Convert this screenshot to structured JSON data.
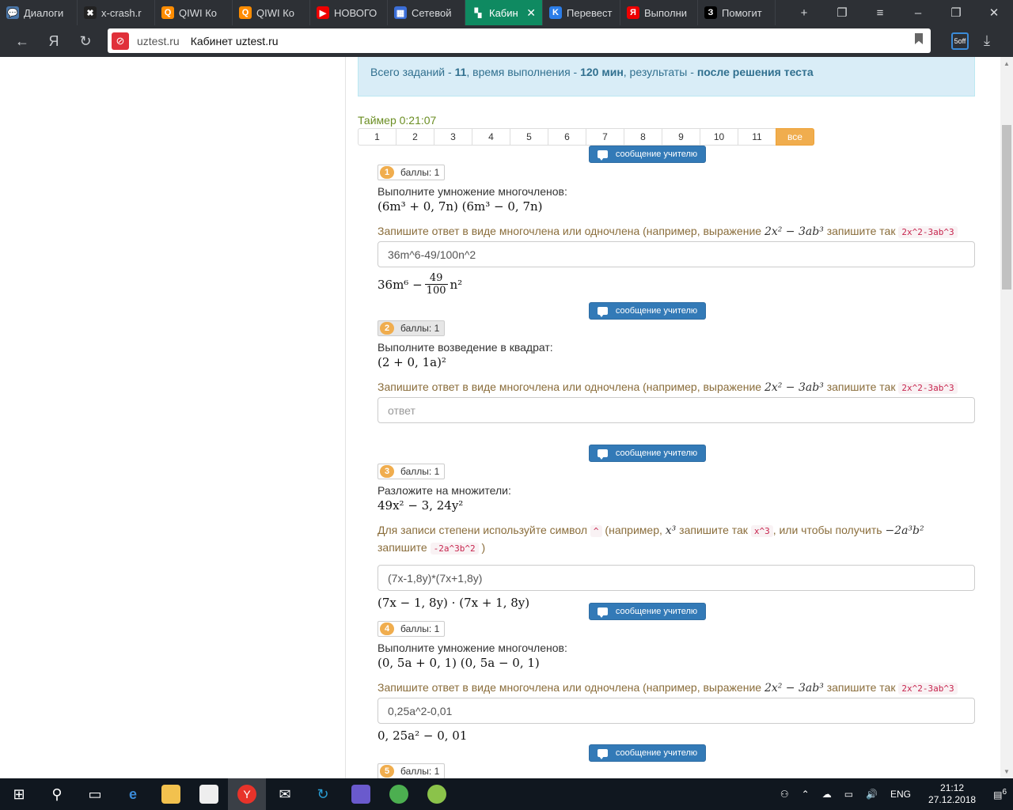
{
  "browser": {
    "tabs": [
      {
        "label": "Диалоги",
        "color": "#4a76a8",
        "glyph": "💬"
      },
      {
        "label": "x-crash.r",
        "color": "#222",
        "glyph": "✖"
      },
      {
        "label": "QIWI Ко",
        "color": "#ff8c00",
        "glyph": "Q"
      },
      {
        "label": "QIWI Ко",
        "color": "#ff8c00",
        "glyph": "Q"
      },
      {
        "label": "НОВОГО",
        "color": "#e00",
        "glyph": "▶"
      },
      {
        "label": "Сетевой",
        "color": "#3b6ed8",
        "glyph": "▦"
      },
      {
        "label": "Кабин",
        "color": "#0f8a61",
        "glyph": "▚",
        "active": true
      },
      {
        "label": "Перевест",
        "color": "#2b7de9",
        "glyph": "K"
      },
      {
        "label": "Выполни",
        "color": "#e00",
        "glyph": "Я"
      },
      {
        "label": "Помогит",
        "color": "#000",
        "glyph": "З"
      }
    ],
    "host": "uztest.ru",
    "page_title": "Кабинет uztest.ru",
    "ext_label": "off",
    "ext_num": "5"
  },
  "info": {
    "p1": "Всего заданий - ",
    "count": "11",
    "p2": ", время выполнения - ",
    "time": "120 мин",
    "p3": ", результаты - ",
    "results": "после решения теста"
  },
  "timer": "Таймер 0:21:07",
  "pager": [
    "1",
    "2",
    "3",
    "4",
    "5",
    "6",
    "7",
    "8",
    "9",
    "10",
    "11",
    "все"
  ],
  "msg_button": "сообщение  учителю",
  "score_label": "баллы: 1",
  "hint_poly": {
    "pre": "Запишите ответ в виде многочлена или одночлена (например, выражение ",
    "expr": "2x² − 3ab³",
    "mid": " запишите так ",
    "code": "2x^2-3ab^3"
  },
  "hint_pow": {
    "pre": "Для записи степени используйте символ ",
    "code1": "^",
    "mid1": " (например, ",
    "expr1": "x³",
    "mid2": " запишите так ",
    "code2": "x^3",
    "mid3": ", или чтобы получить ",
    "expr2": "−2a³b²",
    "mid4": " запишите ",
    "code3": "-2a^3b^2",
    "post": " )"
  },
  "questions": [
    {
      "num": "1",
      "text": "Выполните умножение многочленов:",
      "math": "(6m³ + 0, 7n) (6m³ − 0, 7n)",
      "answer": "36m^6-49/100n^2",
      "render_pre": "36m⁶ −",
      "frac_num": "49",
      "frac_den": "100",
      "render_post": "n²"
    },
    {
      "num": "2",
      "text": "Выполните возведение в квадрат:",
      "math": "(2 + 0, 1a)²",
      "placeholder": "ответ"
    },
    {
      "num": "3",
      "text": "Разложите на множители:",
      "math": "49x² − 3, 24y²",
      "answer": "(7x-1,8y)*(7x+1,8y)",
      "render": "(7x − 1, 8y) · (7x + 1, 8y)"
    },
    {
      "num": "4",
      "text": "Выполните умножение многочленов:",
      "math": "(0, 5a + 0, 1) (0, 5a − 0, 1)",
      "answer": "0,25a^2-0,01",
      "render": "0, 25a² − 0, 01"
    },
    {
      "num": "5"
    }
  ],
  "taskbar": {
    "lang": "ENG",
    "time": "21:12",
    "date": "27.12.2018",
    "notif_count": "6"
  }
}
